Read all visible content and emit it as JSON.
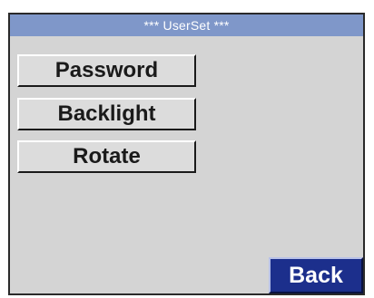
{
  "window": {
    "title": "***   UserSet ***"
  },
  "menu": {
    "items": [
      {
        "label": "Password"
      },
      {
        "label": "Backlight"
      },
      {
        "label": "Rotate"
      }
    ]
  },
  "footer": {
    "back_label": "Back"
  },
  "colors": {
    "title_bar": "#7f97c9",
    "screen_background": "#d4d4d4",
    "button_face": "#dcdcdc",
    "back_button": "#1c2f8c"
  }
}
